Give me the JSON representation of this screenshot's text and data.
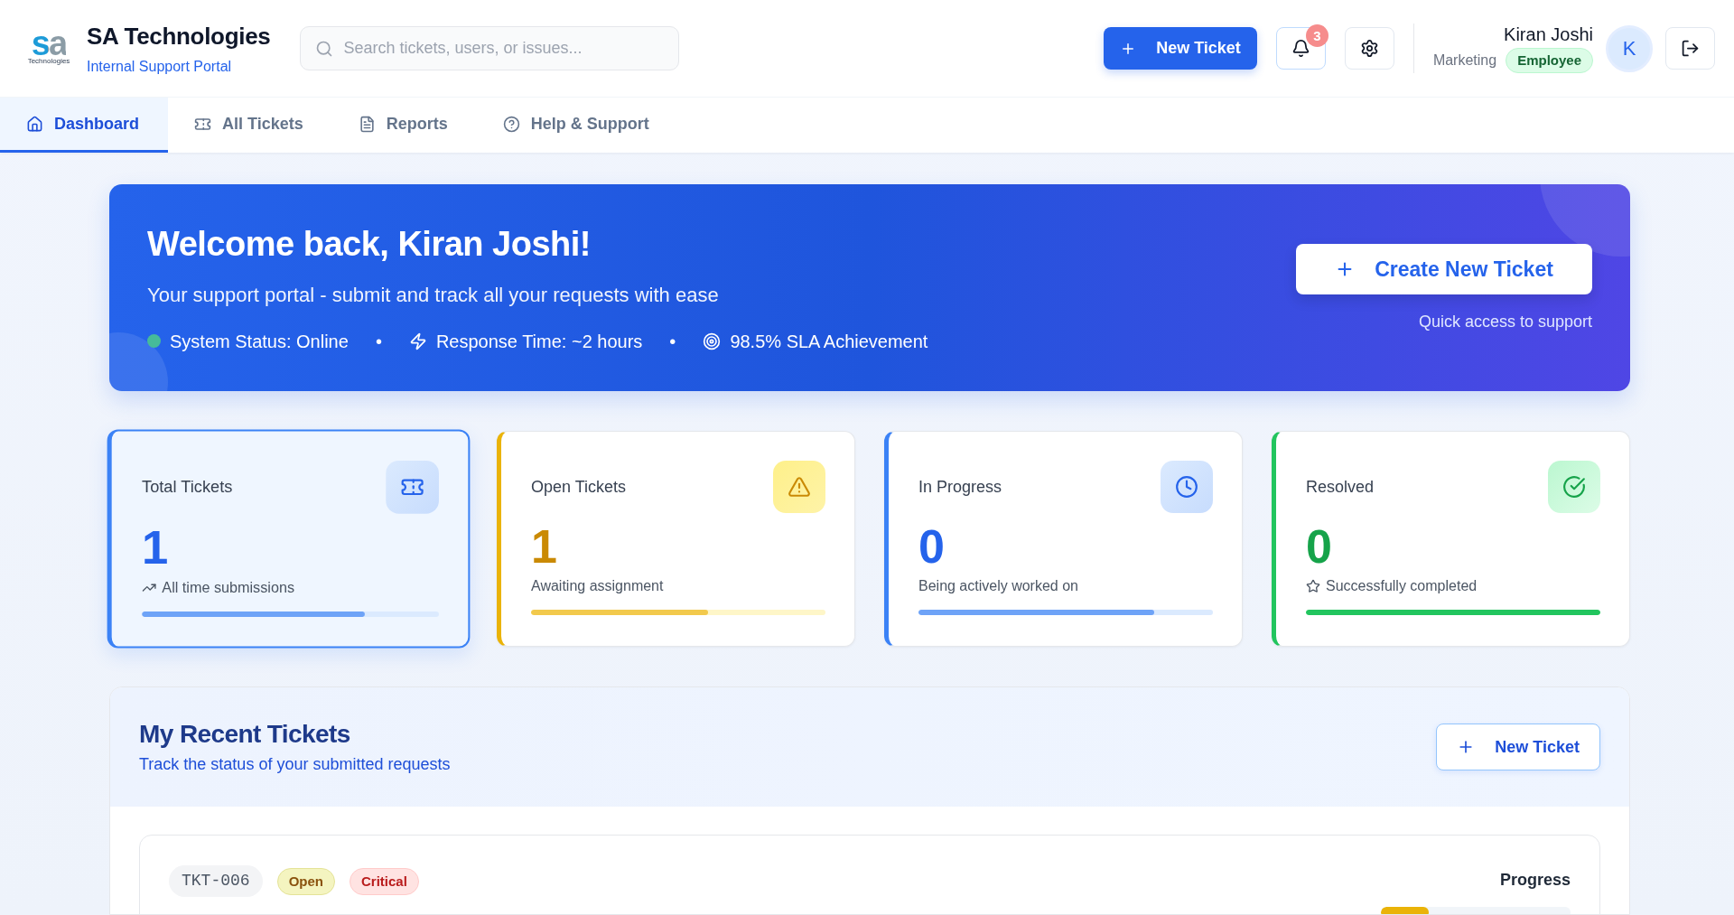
{
  "brand": {
    "logo_mark": "sa",
    "logo_caption": "Technologies",
    "title": "SA Technologies",
    "subtitle": "Internal Support Portal"
  },
  "search": {
    "placeholder": "Search tickets, users, or issues..."
  },
  "header_actions": {
    "new_ticket_label": "New Ticket",
    "notification_count": "3"
  },
  "user": {
    "name": "Kiran Joshi",
    "department": "Marketing",
    "role": "Employee",
    "initial": "K"
  },
  "tabs": [
    {
      "kind": "home",
      "label": "Dashboard",
      "selected": true
    },
    {
      "kind": "tickets",
      "label": "All Tickets",
      "selected": false
    },
    {
      "kind": "reports",
      "label": "Reports",
      "selected": false
    },
    {
      "kind": "help",
      "label": "Help & Support",
      "selected": false
    }
  ],
  "banner": {
    "title": "Welcome back, Kiran Joshi!",
    "subtitle": "Your support portal - submit and track all your requests with ease",
    "separator": "•",
    "status_items": [
      {
        "kind": "status",
        "text": "System Status: Online",
        "color": "#46bb9a"
      },
      {
        "kind": "response",
        "text": "Response Time: ~2 hours"
      },
      {
        "kind": "sla",
        "text": "98.5% SLA Achievement"
      }
    ],
    "button_label": "Create New Ticket",
    "button_caption": "Quick access to support"
  },
  "stats": [
    {
      "kind": "total",
      "title": "Total Tickets",
      "value": "1",
      "description": "All time submissions",
      "level": 0.75,
      "selected": true
    },
    {
      "kind": "open",
      "title": "Open Tickets",
      "value": "1",
      "description": "Awaiting assignment",
      "level": 0.6,
      "selected": false
    },
    {
      "kind": "progress",
      "title": "In Progress",
      "value": "0",
      "description": "Being actively worked on",
      "level": 0.8,
      "selected": false
    },
    {
      "kind": "resolved",
      "title": "Resolved",
      "value": "0",
      "description": "Successfully completed",
      "level": 1,
      "selected": false
    }
  ],
  "recent_tickets": {
    "title": "My Recent Tickets",
    "subtitle": "Track the status of your submitted requests",
    "button_label": "New Ticket",
    "tickets": [
      {
        "id": "TKT-006",
        "tags": [
          {
            "text": "Open",
            "color": "#8a520e"
          },
          {
            "text": "Critical",
            "color": "#b91c1c"
          }
        ],
        "progress_label": "Progress",
        "level": 0.25
      }
    ]
  }
}
